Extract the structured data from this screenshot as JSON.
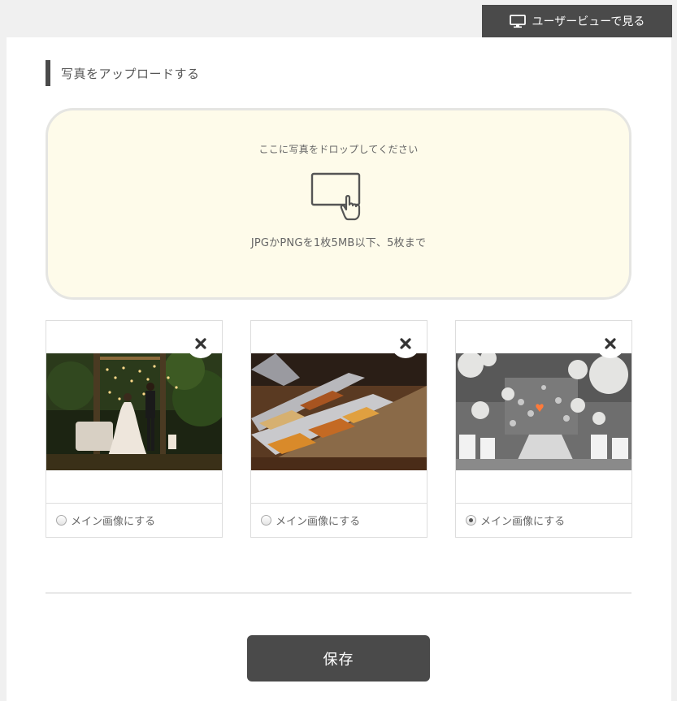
{
  "header": {
    "user_view_label": "ユーザービューで見る",
    "user_view_icon": "monitor-icon"
  },
  "upload": {
    "section_title": "写真をアップロードする",
    "drop_text": "ここに写真をドロップしてください",
    "drop_icon": "hand-pointer-screen-icon",
    "drop_note": "JPGかPNGを1枚5MB以下、5枚まで"
  },
  "photos": [
    {
      "alt": "wedding-couple-night-garden",
      "main_label": "メイン画像にする",
      "is_main": false
    },
    {
      "alt": "buffet-food-trays",
      "main_label": "メイン画像にする",
      "is_main": false
    },
    {
      "alt": "white-balloon-venue",
      "main_label": "メイン画像にする",
      "is_main": true
    }
  ],
  "actions": {
    "save_label": "保存"
  },
  "colors": {
    "dark_button": "#4a4a4a",
    "dropzone_bg": "#fefbea",
    "page_bg": "#f0f0f0"
  }
}
